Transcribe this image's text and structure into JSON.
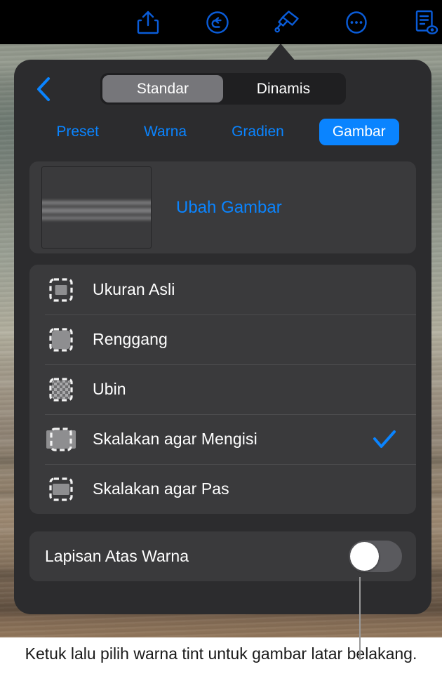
{
  "toolbar": {
    "icons": [
      {
        "name": "share-icon",
        "label": "Bagikan"
      },
      {
        "name": "undo-icon",
        "label": "Batalkan"
      },
      {
        "name": "paintbrush-icon",
        "label": "Format"
      },
      {
        "name": "more-options-icon",
        "label": "Lainnya"
      },
      {
        "name": "document-preview-icon",
        "label": "Dokumen"
      }
    ],
    "background": "#000000",
    "accent": "#0a5cd8"
  },
  "panel": {
    "back_icon": "chevron-left-icon",
    "background": "#2c2c2e",
    "segmented": {
      "options": [
        {
          "label": "Standar",
          "selected": true
        },
        {
          "label": "Dinamis",
          "selected": false
        }
      ],
      "selected_value": "Standar",
      "track_color": "#1f1f21",
      "pill_color": "#76767a"
    },
    "tabs": [
      {
        "label": "Preset",
        "active": false
      },
      {
        "label": "Warna",
        "active": false
      },
      {
        "label": "Gradien",
        "active": false
      },
      {
        "label": "Gambar",
        "active": true
      }
    ],
    "tab_accent": "#0a84ff",
    "image_row": {
      "thumbnail_name": "background-image-thumbnail",
      "action_label": "Ubah Gambar"
    },
    "scale_options": [
      {
        "label": "Ukuran Asli",
        "icon": "original-size-icon",
        "checked": false
      },
      {
        "label": "Renggang",
        "icon": "stretch-icon",
        "checked": false
      },
      {
        "label": "Ubin",
        "icon": "tile-icon",
        "checked": false
      },
      {
        "label": "Skalakan agar Mengisi",
        "icon": "scale-to-fill-icon",
        "checked": true
      },
      {
        "label": "Skalakan agar Pas",
        "icon": "scale-to-fit-icon",
        "checked": false
      }
    ],
    "checkmark_color": "#0a84ff",
    "tint": {
      "label": "Lapisan Atas Warna",
      "toggle_name": "color-overlay-toggle",
      "toggle_on": false,
      "toggle_state_text": "Nonaktif"
    }
  },
  "callout": {
    "text": "Ketuk lalu pilih warna tint untuk gambar latar belakang.",
    "line_color": "#9a9a9a"
  }
}
